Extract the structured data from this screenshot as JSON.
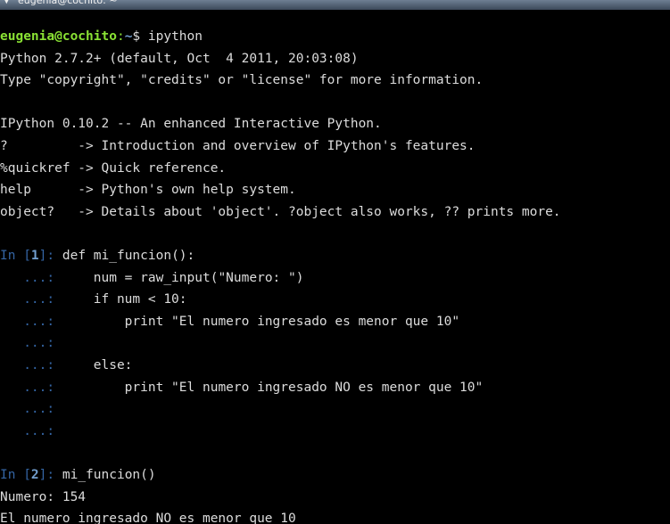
{
  "window": {
    "title": "eugenia@cochito: ~"
  },
  "colors": {
    "background": "#000000",
    "text": "#dcdcdc",
    "user_host": "#8ae234",
    "path": "#729fcf",
    "ipython_prompt": "#3465a4"
  },
  "terminal": {
    "shell_prompt": {
      "user_host": "eugenia@cochito",
      "separator": ":",
      "path": "~",
      "symbol": "$ ",
      "command": "ipython"
    },
    "banner": [
      "Python 2.7.2+ (default, Oct  4 2011, 20:03:08)",
      "Type \"copyright\", \"credits\" or \"license\" for more information.",
      "",
      "IPython 0.10.2 -- An enhanced Interactive Python.",
      "?         -> Introduction and overview of IPython's features.",
      "%quickref -> Quick reference.",
      "help      -> Python's own help system.",
      "object?   -> Details about 'object'. ?object also works, ?? prints more."
    ],
    "cell1": {
      "prompt_in": "In [",
      "number": "1",
      "prompt_close": "]: ",
      "first_line": "def mi_funcion():",
      "continuation_prompt": "   ...: ",
      "body": [
        "    num = raw_input(\"Numero: \")",
        "    if num < 10:",
        "        print \"El numero ingresado es menor que 10\"",
        "",
        "    else:",
        "        print \"El numero ingresado NO es menor que 10\"",
        "",
        ""
      ]
    },
    "cell2": {
      "prompt_in": "In [",
      "number": "2",
      "prompt_close": "]: ",
      "first_line": "mi_funcion()"
    },
    "output": [
      "Numero: 154",
      "El numero ingresado NO es menor que 10"
    ]
  }
}
